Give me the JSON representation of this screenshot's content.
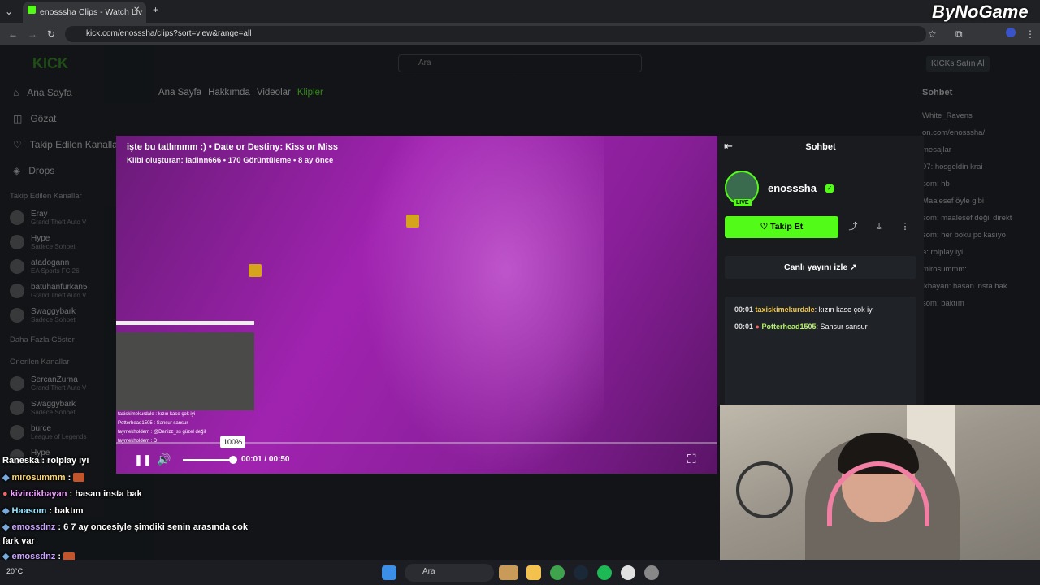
{
  "browser": {
    "tab_title": "enosssha Clips - Watch Liv",
    "url": "kick.com/enosssha/clips?sort=view&range=all"
  },
  "watermark": "ByNoGame",
  "site": {
    "logo": "KICK",
    "search_placeholder": "Ara",
    "buy_kicks": "KICKs Satın Al",
    "sidebar_nav": [
      "Ana Sayfa",
      "Gözat",
      "Takip Edilen Kanallar",
      "Drops"
    ],
    "followed_header": "Takip Edilen Kanallar",
    "followed": [
      {
        "name": "Eray",
        "game": "Grand Theft Auto V"
      },
      {
        "name": "Hype",
        "game": "Sadece Sohbet"
      },
      {
        "name": "atadogann",
        "game": "EA Sports FC 26"
      },
      {
        "name": "batuhanfurkan5",
        "game": "Grand Theft Auto V"
      },
      {
        "name": "Swaggybark",
        "game": "Sadece Sohbet"
      }
    ],
    "show_more": "Daha Fazla Göster",
    "recommended_header": "Önerilen Kanallar",
    "recommended": [
      {
        "name": "SercanZurna",
        "game": "Grand Theft Auto V"
      },
      {
        "name": "Swaggybark",
        "game": "Sadece Sohbet"
      },
      {
        "name": "burce",
        "game": "League of Legends"
      },
      {
        "name": "Hype",
        "game": "Sadece Sohbet"
      }
    ],
    "profile_tabs": [
      "Ana Sayfa",
      "Hakkımda",
      "Videolar",
      "Klipler"
    ],
    "chat_title": "Sohbet",
    "bg_chat": [
      "White_Ravens",
      "on.com/enosssha/",
      "mesajlar",
      "97: hosgeldin krai",
      "som: hb",
      "Maalesef öyle gibi",
      "som: maalesef değil direkt",
      "som: her boku pc kasıyo",
      "a: rolplay iyi",
      "mirosummm:",
      "ikbayan: hasan insta bak",
      "som: baktım"
    ]
  },
  "player": {
    "title": "işte bu tatlımmm :) • Date or Destiny: Kiss or Miss",
    "subtitle": "Klibi oluşturan: ladinn666 • 170 Görüntüleme • 8 ay önce",
    "time": "00:01 / 00:50",
    "volume_tooltip": "100%",
    "pip_chat": [
      "taxiskimekurdale : kızın kase çok iyi",
      "Potterhead1505 : Sansur sansur",
      "taymekholdem : @Denizz_ss güzel değil",
      "taymekholdem : D"
    ]
  },
  "panel": {
    "header": "Sohbet",
    "channel": "enosssha",
    "live_badge": "LIVE",
    "follow": "Takip Et",
    "watch_live": "Canlı yayını izle",
    "chat": [
      {
        "time": "00:01",
        "user": "taxiskimekurdale",
        "msg": "kızın kase çok iyi"
      },
      {
        "time": "00:01",
        "user": "Potterhead1505",
        "msg": "Sansur sansur"
      }
    ]
  },
  "overlay_chat": [
    {
      "user": "Raneska",
      "msg": "rolplay iyi"
    },
    {
      "user": "mirosummm",
      "msg": ""
    },
    {
      "user": "kivircikbayan",
      "msg": "hasan insta bak"
    },
    {
      "user": "Haasom",
      "msg": "baktım"
    },
    {
      "user": "emossdnz",
      "msg": "6 7 ay oncesiyle şimdiki senin arasında cok fark var"
    },
    {
      "user": "emossdnz",
      "msg": ""
    },
    {
      "user": "mirosummm",
      "msg": ""
    }
  ],
  "taskbar": {
    "search": "Ara",
    "weather": "20°C"
  },
  "colors": {
    "kick_green": "#53fc18"
  }
}
